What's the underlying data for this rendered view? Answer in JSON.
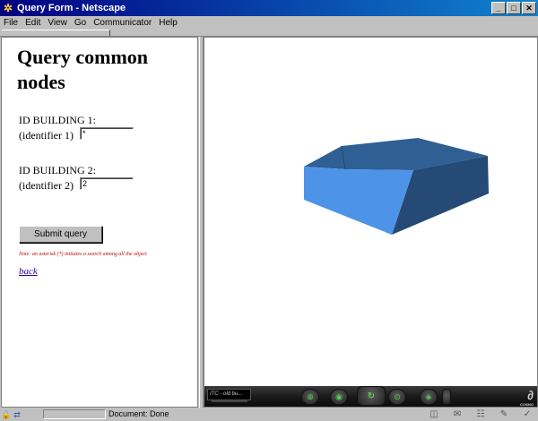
{
  "window": {
    "title": "Query Form - Netscape",
    "app_icon": "netscape-icon"
  },
  "menu": {
    "items": [
      "File",
      "Edit",
      "View",
      "Go",
      "Communicator",
      "Help"
    ]
  },
  "page": {
    "title": "Query common nodes",
    "building1_label": "ID BUILDING 1:",
    "identifier1_label": "(identifier 1)",
    "identifier1_value": "*",
    "building2_label": "ID BUILDING 2:",
    "identifier2_label": "(identifier 2)",
    "identifier2_value": "2",
    "submit_label": "Submit query",
    "note": "Note: an asterisk (*) initiates a search among all the object",
    "back_link": "back"
  },
  "viewer": {
    "viewpoint_label": "ITC - old bu...",
    "logo": "COSMO",
    "shape_colors": {
      "front": "#4d94e8",
      "top": "#2f5f93",
      "side": "#254a75"
    }
  },
  "status": {
    "text": "Document: Done"
  }
}
